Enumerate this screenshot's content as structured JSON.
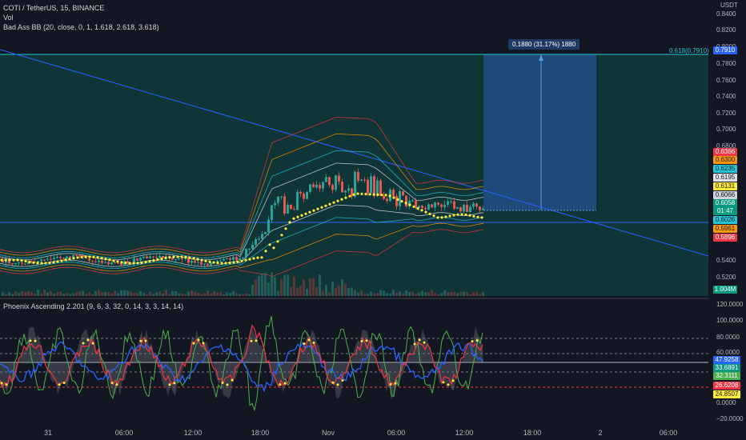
{
  "header": {
    "symbol_line": "COTI / TetherUS, 15, BINANCE",
    "vol_label": "Vol",
    "bb_label": "Bad Ass BB (20, close, 0, 1, 1.618, 2.618, 3.618)",
    "indicator_label": "Phoenix Ascending 2.201 (9, 6, 3, 32, 0, 14, 3, 3, 14, 14)"
  },
  "price_axis": {
    "currency": "USDT",
    "ticks": [
      "0.8400",
      "0.8200",
      "0.8000",
      "0.7800",
      "0.7600",
      "0.7400",
      "0.7200",
      "0.7000",
      "0.6800",
      "0.5400",
      "0.5200"
    ],
    "price_tags": [
      {
        "text": "0.7910",
        "bg": "#2962ff",
        "fg": "#ffffff"
      },
      {
        "text": "0.6366",
        "bg": "#f23645",
        "fg": "#ffffff"
      },
      {
        "text": "0.6300",
        "bg": "#ff9800",
        "fg": "#131722"
      },
      {
        "text": "0.6235",
        "bg": "#26c6da",
        "fg": "#131722"
      },
      {
        "text": "0.6195",
        "bg": "#e0e3eb",
        "fg": "#131722"
      },
      {
        "text": "0.6131",
        "bg": "#ffeb3b",
        "fg": "#131722"
      },
      {
        "text": "0.6066",
        "bg": "#d1d4dc",
        "fg": "#131722"
      },
      {
        "text": "0.6058",
        "bg": "#089981",
        "fg": "#ffffff"
      },
      {
        "text": "01:47",
        "bg": "#089981",
        "fg": "#ffffff"
      },
      {
        "text": "0.6026",
        "bg": "#26c6da",
        "fg": "#131722"
      },
      {
        "text": "0.5961",
        "bg": "#ff9800",
        "fg": "#131722"
      },
      {
        "text": "0.5896",
        "bg": "#f23645",
        "fg": "#ffffff"
      },
      {
        "text": "1.004M",
        "bg": "#089981",
        "fg": "#ffffff"
      }
    ]
  },
  "osc_axis": {
    "ticks": [
      "120.0000",
      "100.0000",
      "80.0000",
      "60.0000",
      "0.0000",
      "−20.0000"
    ],
    "tags": [
      {
        "text": "47.9258",
        "bg": "#2962ff",
        "fg": "#ffffff"
      },
      {
        "text": "33.6891",
        "bg": "#089981",
        "fg": "#ffffff"
      },
      {
        "text": "32.3111",
        "bg": "#4caf50",
        "fg": "#ffffff"
      },
      {
        "text": "26.6208",
        "bg": "#f23645",
        "fg": "#ffffff"
      },
      {
        "text": "24.8507",
        "bg": "#ffeb3b",
        "fg": "#131722"
      }
    ]
  },
  "time_axis": [
    "31",
    "06:00",
    "12:00",
    "18:00",
    "Nov",
    "06:00",
    "12:00",
    "18:00",
    "2",
    "06:00"
  ],
  "measure": {
    "label": "0.1880 (31.17%) 1880",
    "fib_label": "0.618(0.7910)"
  },
  "colors": {
    "bg": "#131722",
    "zone": "#0f3b3a",
    "measure": "#1e4a7a",
    "up": "#26a69a",
    "down": "#ef5350",
    "accent": "#2962ff"
  }
}
